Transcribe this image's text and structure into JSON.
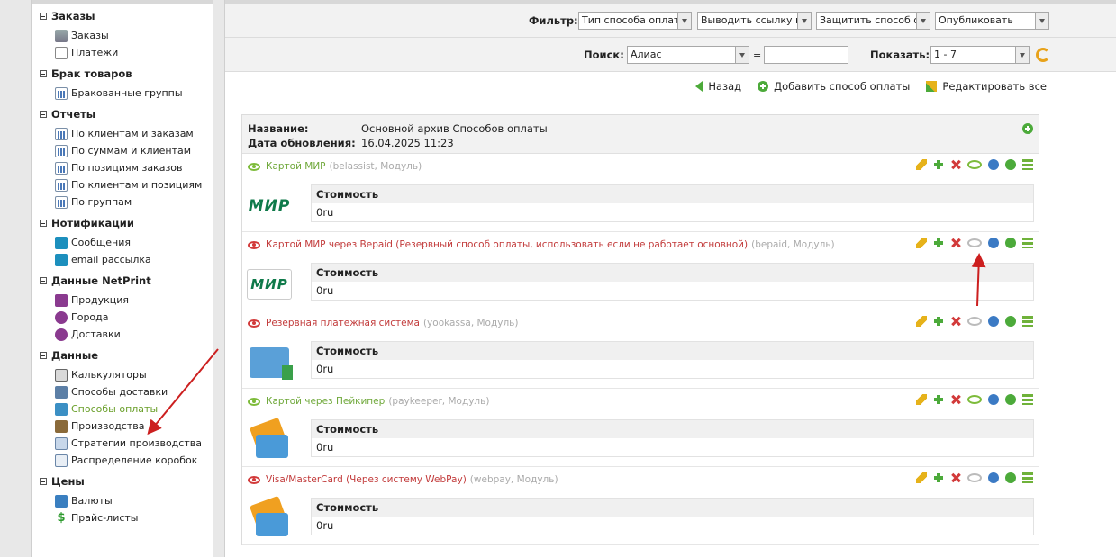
{
  "sidebar": {
    "groups": [
      {
        "title": "Заказы",
        "items": [
          {
            "label": "Заказы",
            "icon": "cart-icon"
          },
          {
            "label": "Платежи",
            "icon": "document-icon"
          }
        ]
      },
      {
        "title": "Брак товаров",
        "items": [
          {
            "label": "Бракованные группы",
            "icon": "chart-icon"
          }
        ]
      },
      {
        "title": "Отчеты",
        "items": [
          {
            "label": "По клиентам и заказам",
            "icon": "chart-icon"
          },
          {
            "label": "По суммам и клиентам",
            "icon": "chart-icon"
          },
          {
            "label": "По позициям заказов",
            "icon": "chart-icon"
          },
          {
            "label": "По клиентам и позициям",
            "icon": "chart-icon"
          },
          {
            "label": "По группам",
            "icon": "chart-icon"
          }
        ]
      },
      {
        "title": "Нотификации",
        "items": [
          {
            "label": "Сообщения",
            "icon": "chat-icon"
          },
          {
            "label": "email рассылка",
            "icon": "chat-icon"
          }
        ]
      },
      {
        "title": "Данные NetPrint",
        "items": [
          {
            "label": "Продукция",
            "icon": "product-icon"
          },
          {
            "label": "Города",
            "icon": "city-icon"
          },
          {
            "label": "Доставки",
            "icon": "delivery-icon"
          }
        ]
      },
      {
        "title": "Данные",
        "items": [
          {
            "label": "Калькуляторы",
            "icon": "calculator-icon"
          },
          {
            "label": "Способы доставки",
            "icon": "truck-icon"
          },
          {
            "label": "Способы оплаты",
            "icon": "card-icon",
            "active": true
          },
          {
            "label": "Производства",
            "icon": "factory-icon"
          },
          {
            "label": "Стратегии производства",
            "icon": "strategy-icon"
          },
          {
            "label": "Распределение коробок",
            "icon": "box-icon"
          }
        ]
      },
      {
        "title": "Цены",
        "items": [
          {
            "label": "Валюты",
            "icon": "coin-icon"
          },
          {
            "label": "Прайс-листы",
            "icon": "dollar-icon"
          }
        ]
      }
    ]
  },
  "filter": {
    "label": "Фильтр:",
    "selects": [
      "Тип способа оплаты",
      "Выводить ссылку на",
      "Защитить способ опл",
      "Опубликовать"
    ]
  },
  "search": {
    "label": "Поиск:",
    "field_select": "Алиас",
    "equals": "=",
    "value": "",
    "show_label": "Показать:",
    "show_value": "1 - 7"
  },
  "actions": {
    "back": "Назад",
    "add": "Добавить способ оплаты",
    "edit_all": "Редактировать все"
  },
  "info": {
    "name_label": "Название:",
    "name_value": "Основной архив Способов оплаты",
    "date_label": "Дата обновления:",
    "date_value": "16.04.2025 11:23"
  },
  "methods": [
    {
      "name": "Картой МИР",
      "meta": "(belassist, Модуль)",
      "published": true,
      "logo": "МИР",
      "cost_label": "Стоимость",
      "cost": "0ru"
    },
    {
      "name": "Картой МИР через Bepaid (Резервный способ оплаты, использовать если не работает основной)",
      "meta": "(bepaid, Модуль)",
      "published": false,
      "logo": "МИР",
      "cost_label": "Стоимость",
      "cost": "0ru"
    },
    {
      "name": "Резервная платёжная система",
      "meta": "(yookassa, Модуль)",
      "published": false,
      "logo": "",
      "cost_label": "Стоимость",
      "cost": "0ru"
    },
    {
      "name": "Картой через Пейкипер",
      "meta": "(paykeeper, Модуль)",
      "published": true,
      "logo": "",
      "cost_label": "Стоимость",
      "cost": "0ru"
    },
    {
      "name": "Visa/MasterCard (Через систему WebPay)",
      "meta": "(webpay, Модуль)",
      "published": false,
      "logo": "",
      "cost_label": "Стоимость",
      "cost": "0ru"
    }
  ],
  "colors": {
    "published": "#6fa83a",
    "unpublished": "#c23a3a",
    "annotation_arrow": "#cc1f1f"
  }
}
